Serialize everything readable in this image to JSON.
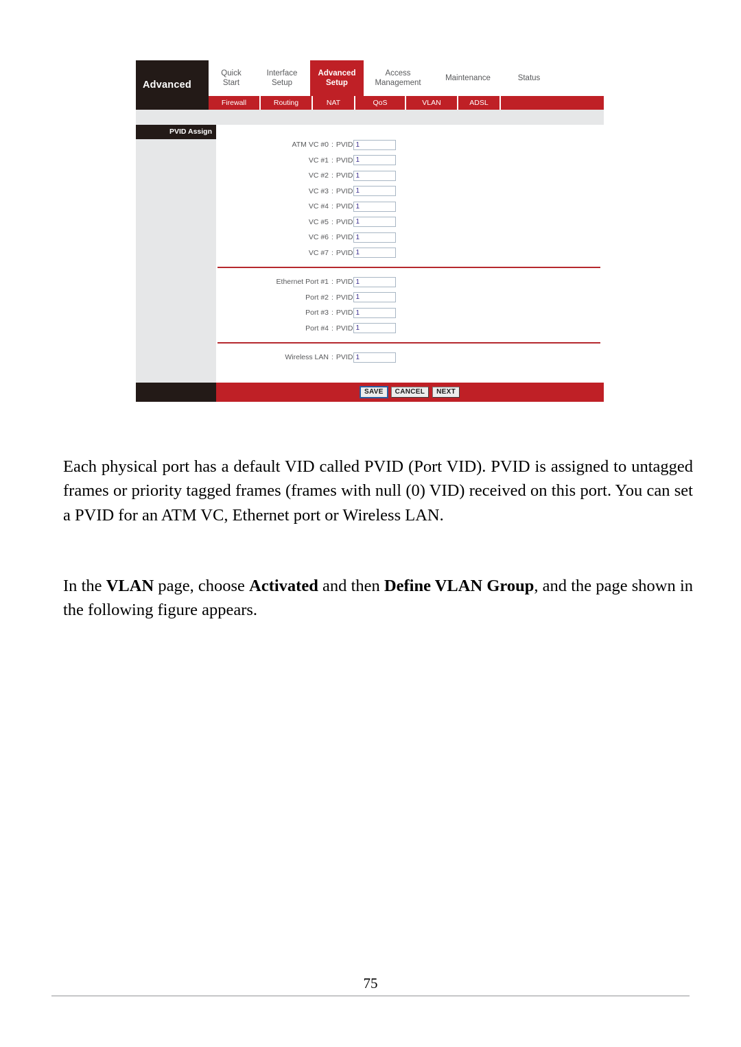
{
  "router_ui": {
    "brand_label": "Advanced",
    "top_tabs": [
      {
        "line1": "Quick",
        "line2": "Start",
        "active": false
      },
      {
        "line1": "Interface",
        "line2": "Setup",
        "active": false
      },
      {
        "line1": "Advanced",
        "line2": "Setup",
        "active": true
      },
      {
        "line1": "Access",
        "line2": "Management",
        "active": false
      },
      {
        "line1": "Maintenance",
        "line2": "",
        "active": false
      },
      {
        "line1": "Status",
        "line2": "",
        "active": false
      }
    ],
    "sub_tabs": [
      {
        "label": "Firewall"
      },
      {
        "label": "Routing"
      },
      {
        "label": "NAT"
      },
      {
        "label": "QoS"
      },
      {
        "label": "VLAN"
      },
      {
        "label": "ADSL"
      }
    ],
    "section_title": "PVID Assign",
    "field_tag": "PVID",
    "separator": ":",
    "atm_rows": [
      {
        "label": "ATM VC #0",
        "value": "1"
      },
      {
        "label": "VC #1",
        "value": "1"
      },
      {
        "label": "VC #2",
        "value": "1"
      },
      {
        "label": "VC #3",
        "value": "1"
      },
      {
        "label": "VC #4",
        "value": "1"
      },
      {
        "label": "VC #5",
        "value": "1"
      },
      {
        "label": "VC #6",
        "value": "1"
      },
      {
        "label": "VC #7",
        "value": "1"
      }
    ],
    "ethernet_rows": [
      {
        "label": "Ethernet Port #1",
        "value": "1"
      },
      {
        "label": "Port #2",
        "value": "1"
      },
      {
        "label": "Port #3",
        "value": "1"
      },
      {
        "label": "Port #4",
        "value": "1"
      }
    ],
    "wireless_rows": [
      {
        "label": "Wireless LAN",
        "value": "1"
      }
    ],
    "buttons": {
      "save": "SAVE",
      "cancel": "CANCEL",
      "next": "NEXT"
    },
    "colors": {
      "accent_red": "#bf2026",
      "divider_red": "#b5282d",
      "dark_panel": "#231a17",
      "sidebar_gray": "#e6e7e8"
    }
  },
  "body_text": {
    "paragraph_1": "Each physical port has a default VID called PVID (Port VID). PVID is assigned to untagged frames or priority tagged frames (frames with null (0) VID) received on this port. You can set a PVID for an ATM VC, Ethernet port or Wireless LAN.",
    "paragraph_2": {
      "seg_1": "In the ",
      "bold_1": "VLAN",
      "seg_2": " page, choose ",
      "bold_2": "Activated",
      "seg_3": " and then ",
      "bold_3": "Define VLAN Group",
      "seg_4": ", and the page shown in the following figure appears."
    }
  },
  "page_footer": {
    "page_number": "75"
  }
}
